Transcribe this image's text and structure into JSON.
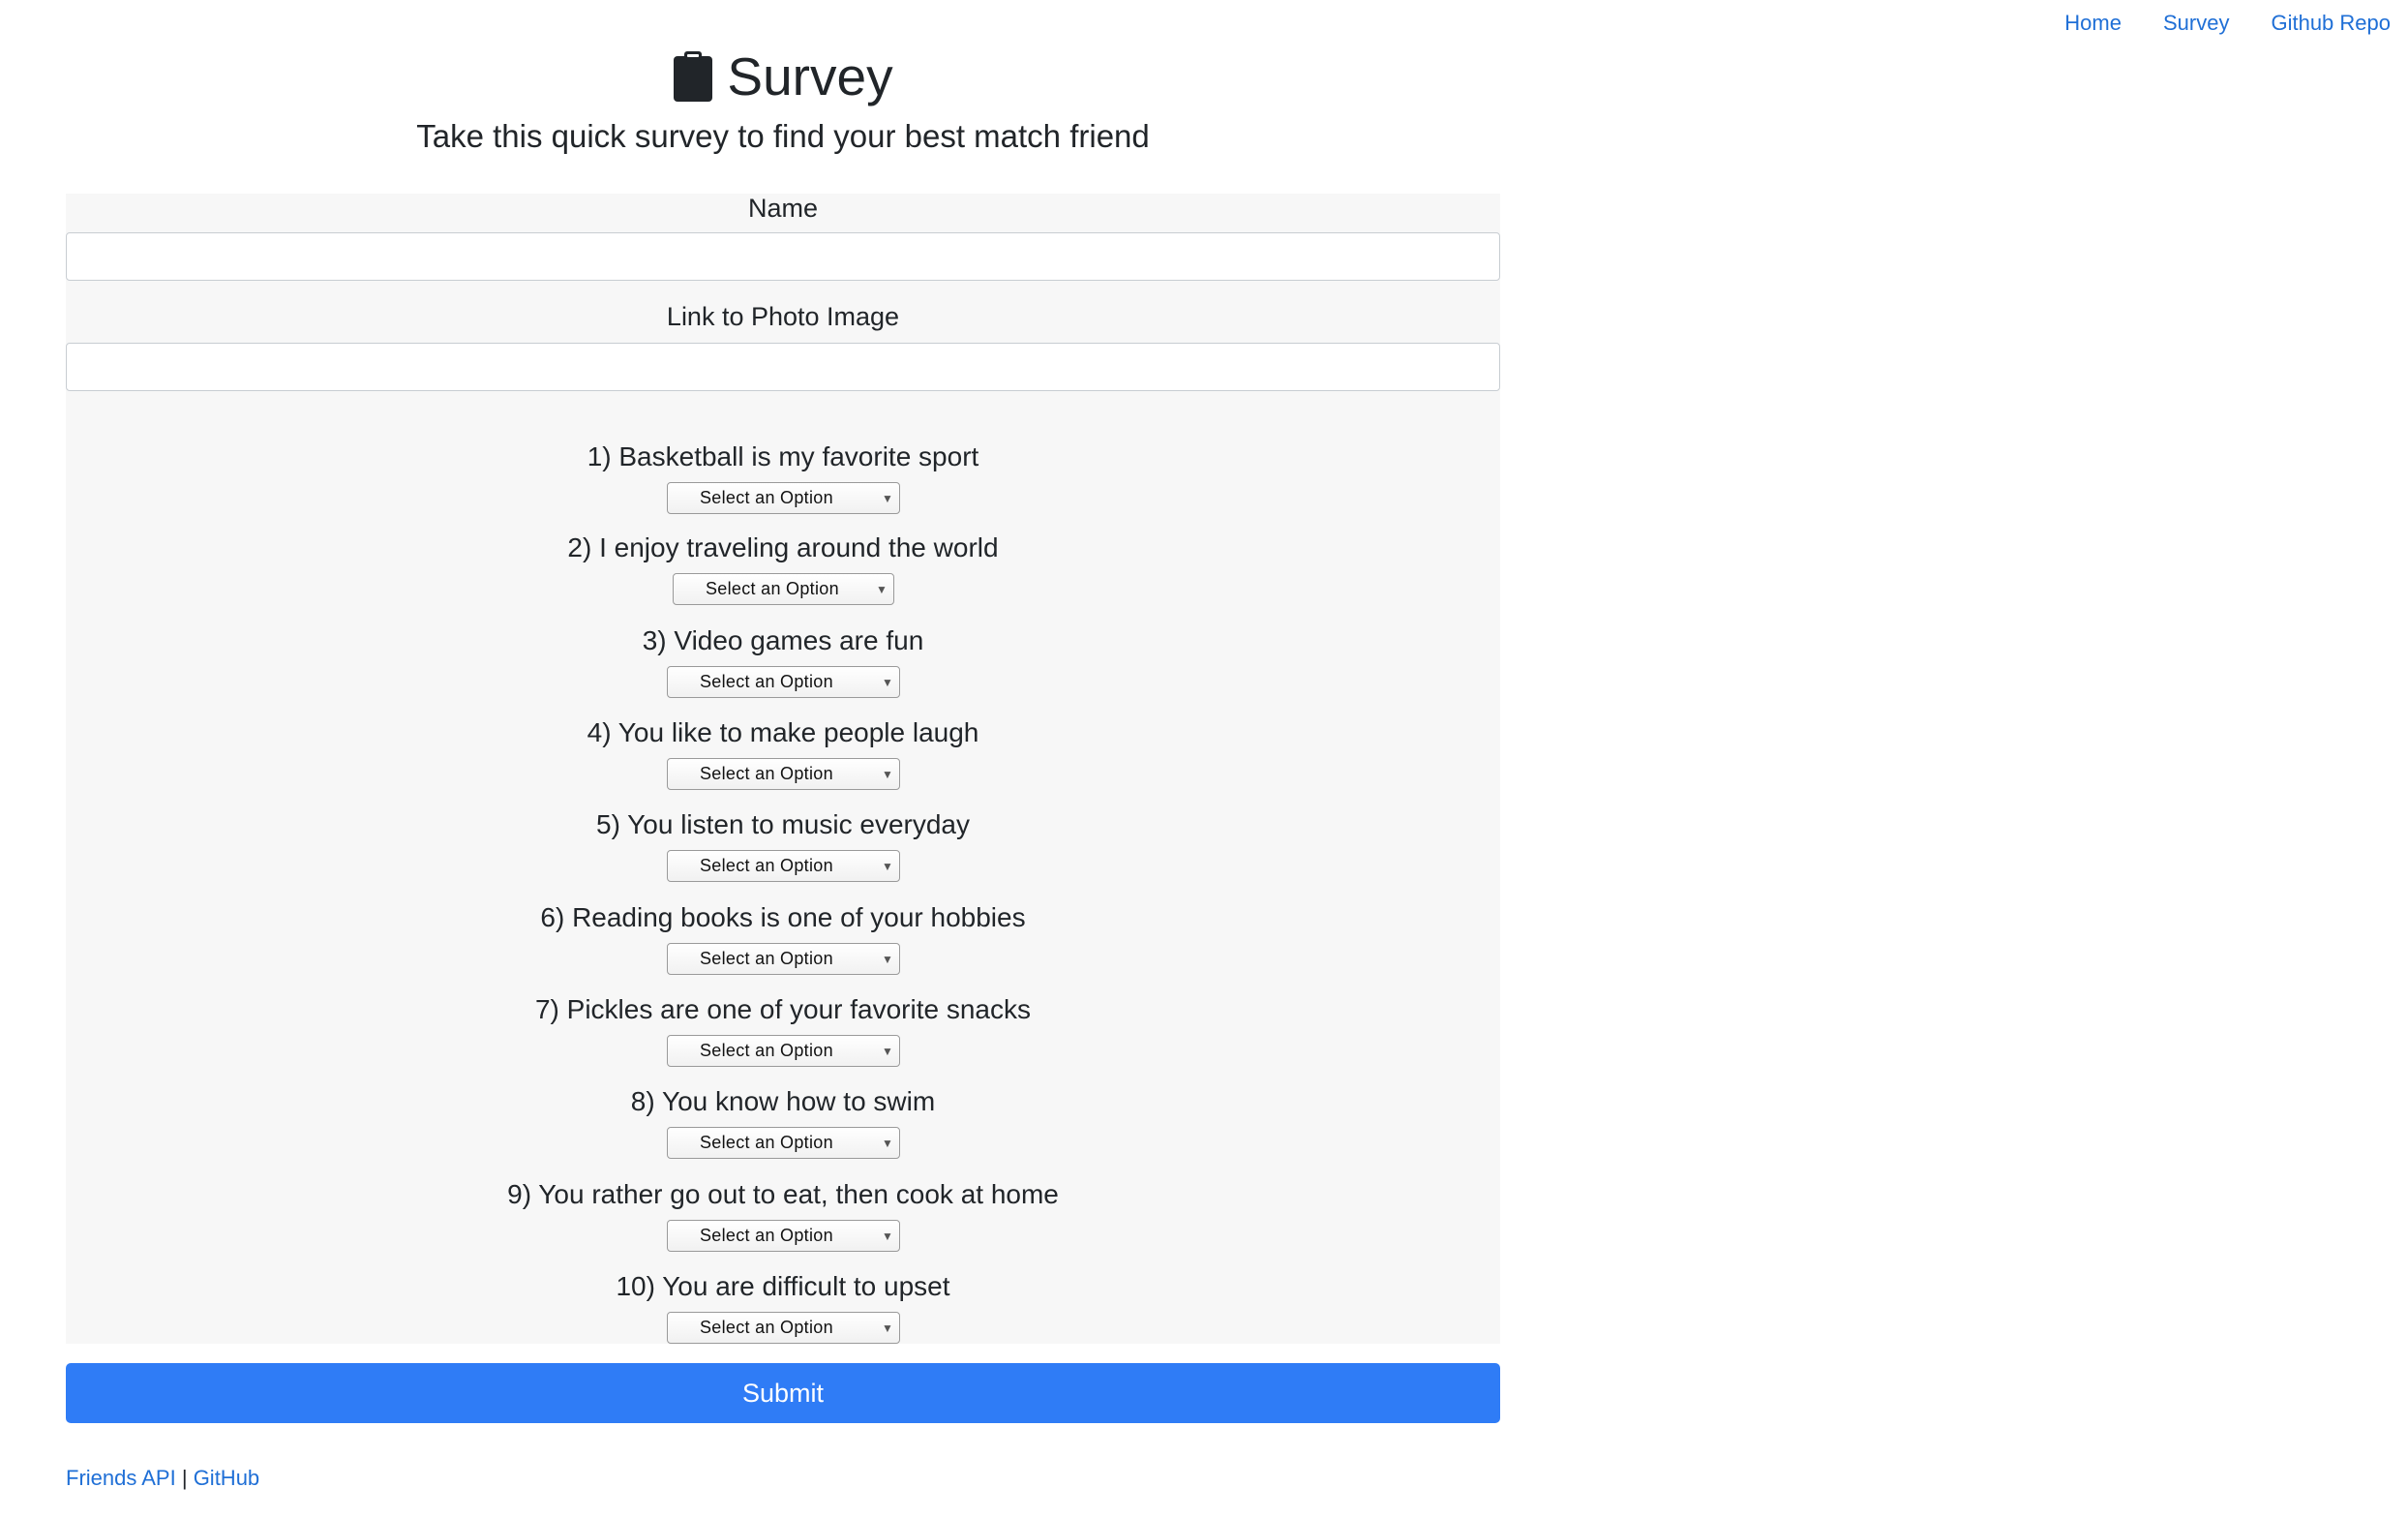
{
  "nav": {
    "links": [
      "Home",
      "Survey",
      "Github Repo"
    ]
  },
  "header": {
    "icon": "clipboard-icon",
    "title": "Survey",
    "subtitle": "Take this quick survey to find your best match friend"
  },
  "form": {
    "name_label": "Name",
    "name_value": "",
    "photo_label": "Link to Photo Image",
    "photo_value": "",
    "select_placeholder": "Select an Option",
    "questions": [
      {
        "label": "1) Basketball is my favorite sport",
        "selected": "Select an Option"
      },
      {
        "label": "2) I enjoy traveling around the world",
        "selected": "Select an Option"
      },
      {
        "label": "3) Video games are fun",
        "selected": "Select an Option"
      },
      {
        "label": "4) You like to make people laugh",
        "selected": "Select an Option"
      },
      {
        "label": "5) You listen to music everyday",
        "selected": "Select an Option"
      },
      {
        "label": "6) Reading books is one of your hobbies",
        "selected": "Select an Option"
      },
      {
        "label": "7) Pickles are one of your favorite snacks",
        "selected": "Select an Option"
      },
      {
        "label": "8) You know how to swim",
        "selected": "Select an Option"
      },
      {
        "label": "9) You rather go out to eat, then cook at home",
        "selected": "Select an Option"
      },
      {
        "label": "10) You are difficult to upset",
        "selected": "Select an Option"
      }
    ],
    "submit_label": "Submit"
  },
  "footer": {
    "link1": "Friends API",
    "separator": "|",
    "link2": "GitHub"
  },
  "colors": {
    "link": "#1f6fd6",
    "submit": "#2f7cf6",
    "panel": "#f7f7f7"
  }
}
